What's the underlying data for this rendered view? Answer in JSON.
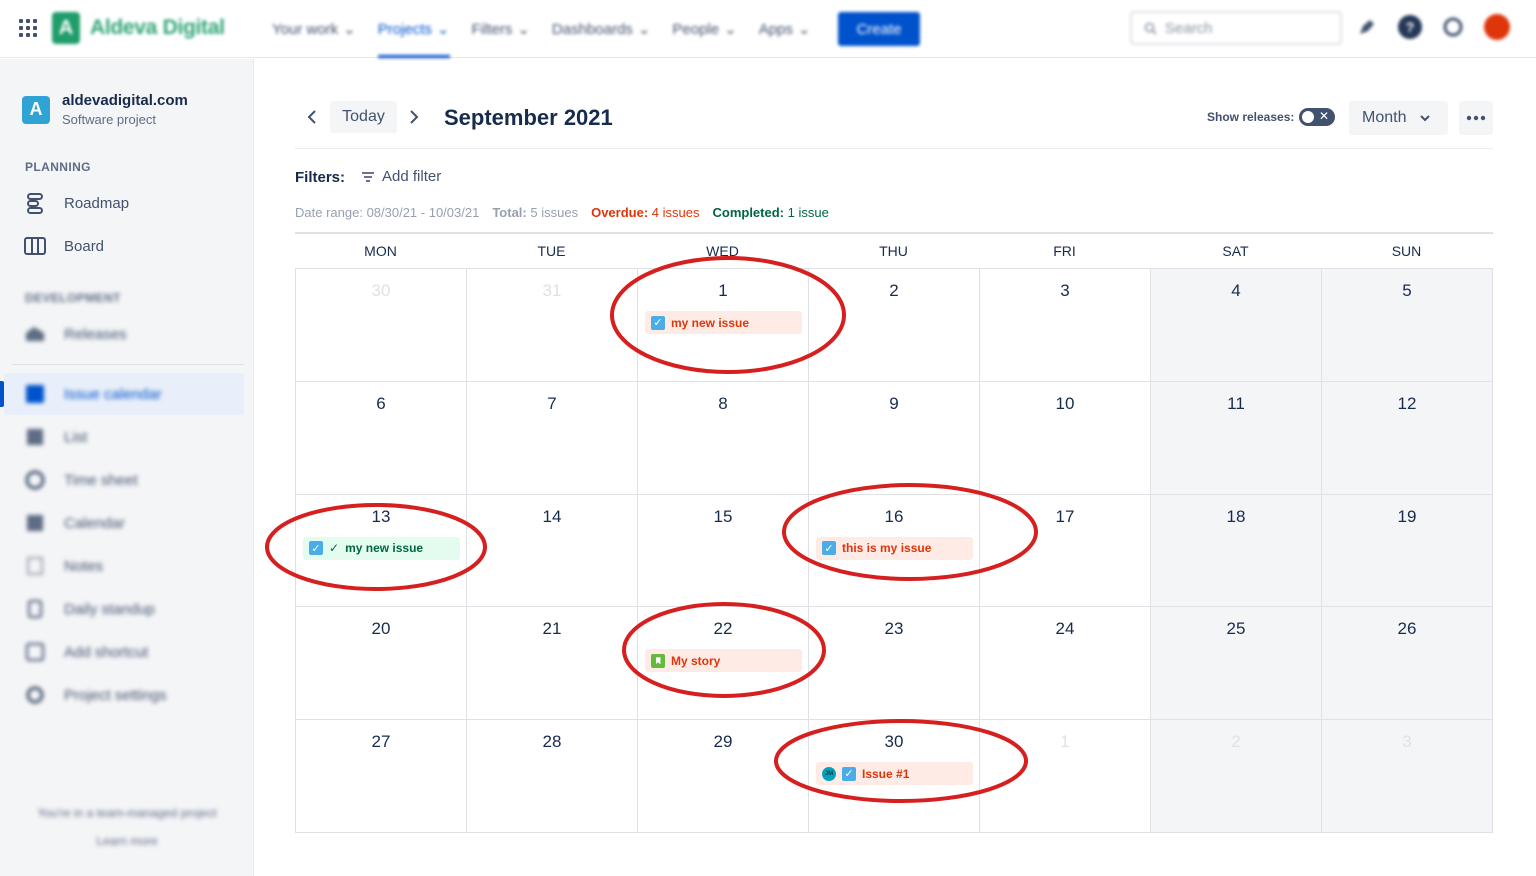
{
  "topbar": {
    "app_name": "Aldeva Digital",
    "nav": [
      {
        "label": "Your work",
        "active": false
      },
      {
        "label": "Projects",
        "active": true
      },
      {
        "label": "Filters",
        "active": false
      },
      {
        "label": "Dashboards",
        "active": false
      },
      {
        "label": "People",
        "active": false
      },
      {
        "label": "Apps",
        "active": false
      }
    ],
    "create_label": "Create",
    "search_placeholder": "Search",
    "icons": [
      "apps-grid-icon",
      "notifications-icon",
      "help-icon",
      "settings-icon",
      "profile-avatar"
    ]
  },
  "sidebar": {
    "project_name": "aldevadigital.com",
    "project_type": "Software project",
    "planning_label": "PLANNING",
    "planning_items": [
      {
        "label": "Roadmap",
        "icon": "roadmap-icon"
      },
      {
        "label": "Board",
        "icon": "board-icon"
      }
    ],
    "development_label": "DEVELOPMENT",
    "development_items": [
      {
        "label": "Releases",
        "icon": "releases-icon"
      }
    ],
    "app_items": [
      {
        "label": "Issue calendar",
        "icon": "calendar-icon",
        "active": true
      },
      {
        "label": "List",
        "icon": "list-icon"
      },
      {
        "label": "Time sheet",
        "icon": "timesheet-icon"
      },
      {
        "label": "Calendar",
        "icon": "calendar-icon"
      },
      {
        "label": "Notes",
        "icon": "notes-icon"
      },
      {
        "label": "Daily standup",
        "icon": "standup-icon"
      },
      {
        "label": "Add shortcut",
        "icon": "add-shortcut-icon"
      },
      {
        "label": "Project settings",
        "icon": "settings-icon"
      }
    ],
    "footer_text": "You're in a team-managed project",
    "footer_link": "Learn more"
  },
  "toolbar": {
    "prev_icon": "chevron-left-icon",
    "today_label": "Today",
    "next_icon": "chevron-right-icon",
    "month_title": "September 2021",
    "show_releases_label": "Show releases:",
    "view_label": "Month",
    "more_icon": "more-icon"
  },
  "filters": {
    "label": "Filters:",
    "add_filter_label": "Add filter"
  },
  "stats": {
    "date_range_label": "Date range:",
    "date_range_value": "08/30/21 - 10/03/21",
    "total_label": "Total:",
    "total_value": "5 issues",
    "overdue_label": "Overdue:",
    "overdue_value": "4 issues",
    "completed_label": "Completed:",
    "completed_value": "1 issue"
  },
  "calendar": {
    "weekdays": [
      "MON",
      "TUE",
      "WED",
      "THU",
      "FRI",
      "SAT",
      "SUN"
    ],
    "weeks": [
      [
        {
          "day": "30",
          "muted": true
        },
        {
          "day": "31",
          "muted": true
        },
        {
          "day": "1",
          "event": {
            "title": "my new issue",
            "type": "task",
            "status": "overdue"
          }
        },
        {
          "day": "2"
        },
        {
          "day": "3"
        },
        {
          "day": "4"
        },
        {
          "day": "5"
        }
      ],
      [
        {
          "day": "6"
        },
        {
          "day": "7"
        },
        {
          "day": "8"
        },
        {
          "day": "9"
        },
        {
          "day": "10"
        },
        {
          "day": "11"
        },
        {
          "day": "12"
        }
      ],
      [
        {
          "day": "13",
          "event": {
            "title": "my new issue",
            "type": "task",
            "status": "completed"
          }
        },
        {
          "day": "14"
        },
        {
          "day": "15"
        },
        {
          "day": "16",
          "event": {
            "title": "this is my issue",
            "type": "task",
            "status": "overdue"
          }
        },
        {
          "day": "17"
        },
        {
          "day": "18"
        },
        {
          "day": "19"
        }
      ],
      [
        {
          "day": "20"
        },
        {
          "day": "21"
        },
        {
          "day": "22",
          "event": {
            "title": "My story",
            "type": "story",
            "status": "overdue"
          }
        },
        {
          "day": "23"
        },
        {
          "day": "24"
        },
        {
          "day": "25"
        },
        {
          "day": "26"
        }
      ],
      [
        {
          "day": "27"
        },
        {
          "day": "28"
        },
        {
          "day": "29"
        },
        {
          "day": "30",
          "event": {
            "title": "Issue #1",
            "type": "task",
            "status": "overdue",
            "assignee": "JM"
          }
        },
        {
          "day": "1",
          "muted": true
        },
        {
          "day": "2",
          "muted": true
        },
        {
          "day": "3",
          "muted": true
        }
      ]
    ]
  },
  "colors": {
    "brand": "#1f9d6b",
    "primary": "#0052cc",
    "overdue_bg": "#ffebe6",
    "overdue_text": "#de350b",
    "done_bg": "#e3fcef",
    "done_text": "#006644",
    "annotation": "#d61f1f"
  }
}
